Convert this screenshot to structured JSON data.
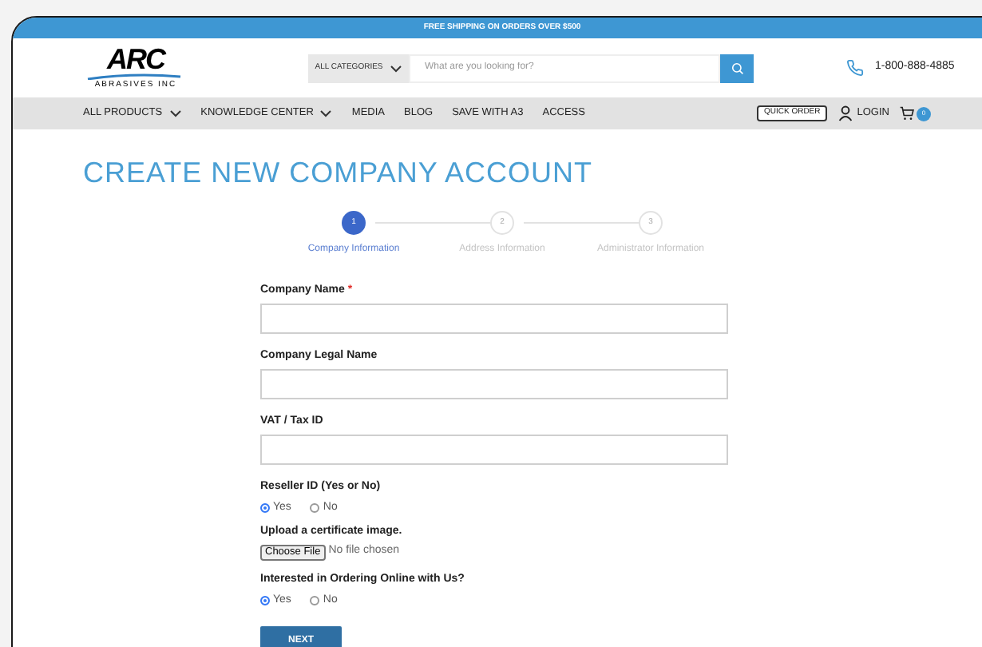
{
  "banner": "FREE SHIPPING ON ORDERS OVER $500",
  "header": {
    "logo": {
      "mark": "ARC",
      "tagline": "ABRASIVES INC"
    },
    "category": "ALL CATEGORIES",
    "search": {
      "placeholder": "What are you looking for?"
    },
    "phone": "1-800-888-4885"
  },
  "nav": {
    "items": [
      {
        "label": "ALL PRODUCTS",
        "dropdown": true
      },
      {
        "label": "KNOWLEDGE CENTER",
        "dropdown": true
      },
      {
        "label": "MEDIA",
        "dropdown": false
      },
      {
        "label": "BLOG",
        "dropdown": false
      },
      {
        "label": "SAVE WITH A3",
        "dropdown": false
      },
      {
        "label": "ACCESS",
        "dropdown": false
      }
    ],
    "quick_order": "QUICK ORDER",
    "login": "LOGIN",
    "cart_count": "0"
  },
  "title": "CREATE NEW COMPANY ACCOUNT",
  "steps": [
    {
      "number": "1",
      "label": "Company Information",
      "selected": true
    },
    {
      "number": "2",
      "label": "Address Information",
      "selected": false
    },
    {
      "number": "3",
      "label": "Administrator Information",
      "selected": false
    }
  ],
  "form": {
    "fields": [
      {
        "kind": "text",
        "label": "Company Name",
        "required_mark": "*"
      },
      {
        "kind": "text",
        "label": "Company Legal Name"
      },
      {
        "kind": "text",
        "label": "VAT / Tax ID"
      },
      {
        "kind": "radio",
        "label": "Reseller ID (Yes or No)",
        "options": [
          {
            "label": "Yes",
            "selected": true
          },
          {
            "label": "No",
            "selected": false
          }
        ]
      },
      {
        "kind": "file",
        "label": "Upload a certificate image.",
        "button": "Choose File",
        "status": "No file chosen"
      },
      {
        "kind": "radio",
        "label": "Interested in Ordering Online with Us?",
        "options": [
          {
            "label": "Yes",
            "selected": true
          },
          {
            "label": "No",
            "selected": false
          }
        ]
      }
    ],
    "submit": "NEXT"
  }
}
